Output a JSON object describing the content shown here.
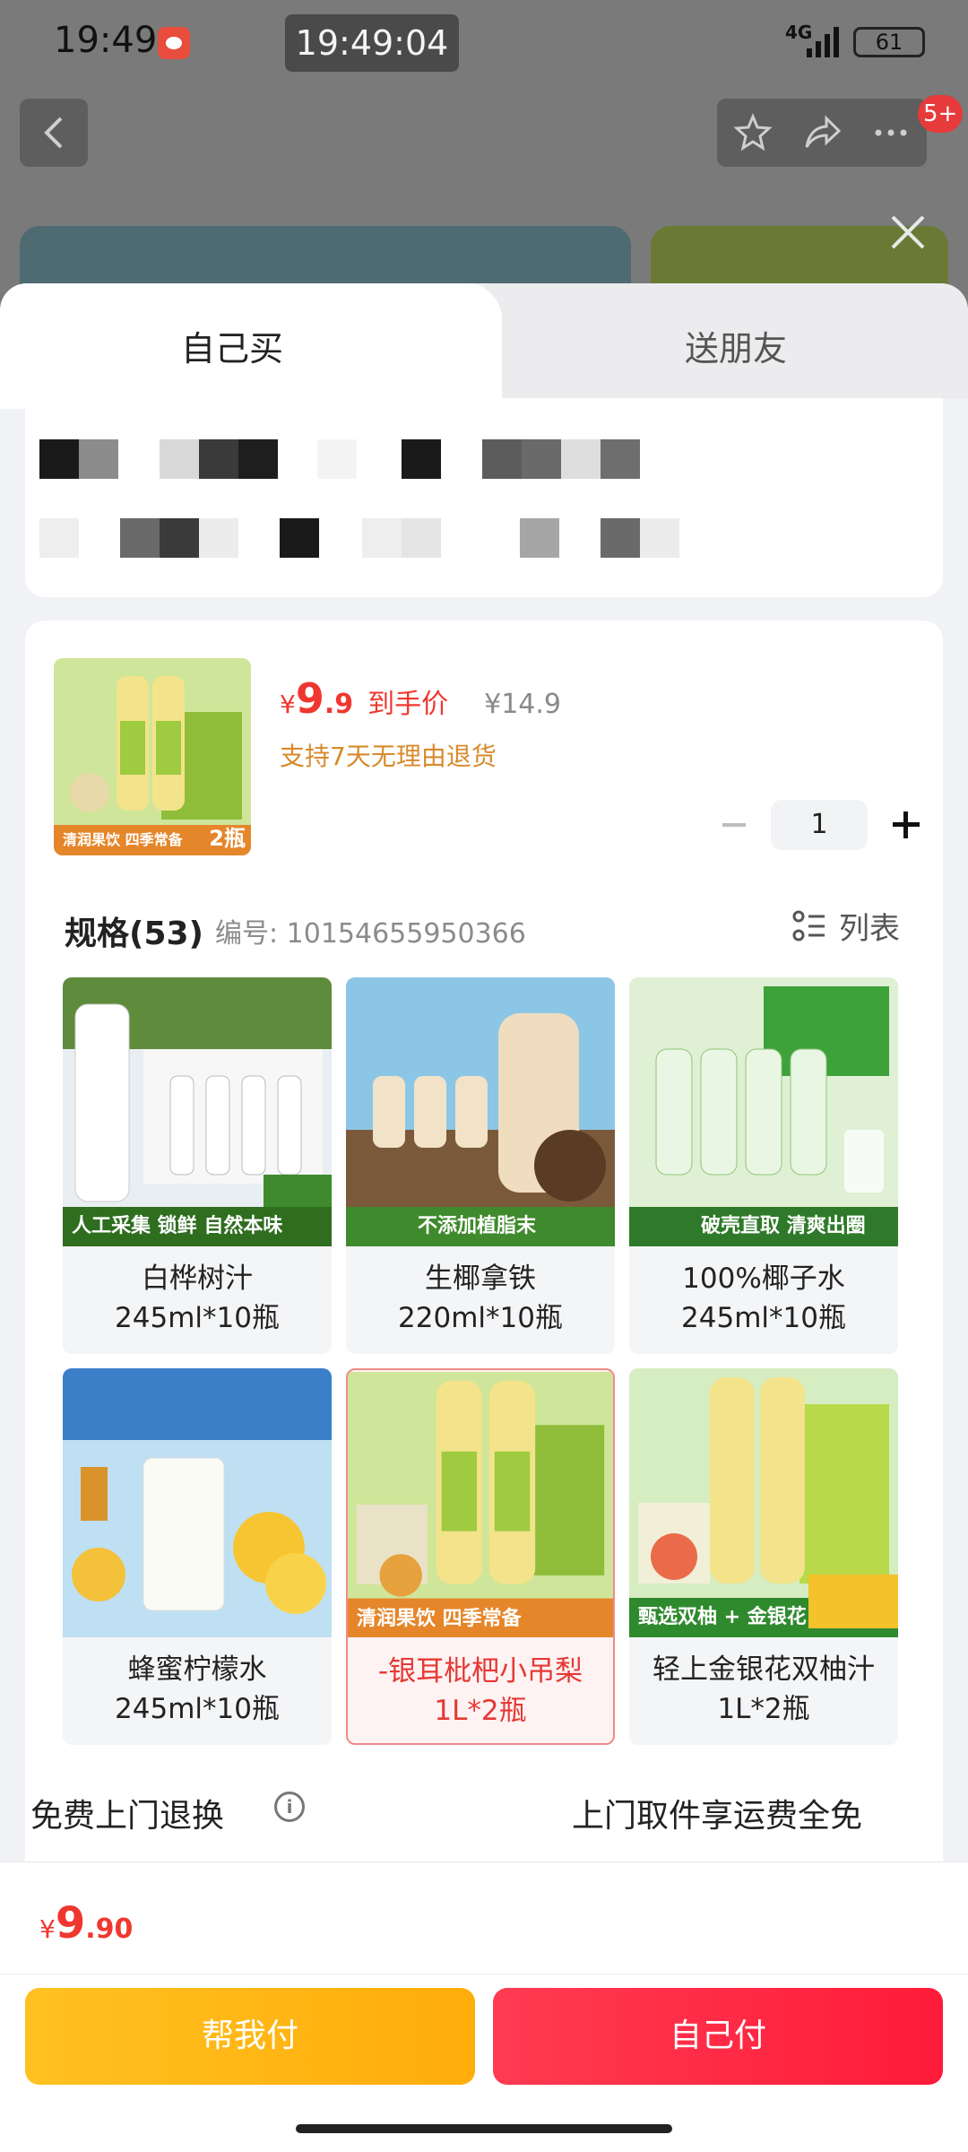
{
  "status_bar": {
    "time": "19:49",
    "clock_overlay": "19:49:04",
    "network": "4G",
    "battery": "61"
  },
  "background": {
    "badge": "5+"
  },
  "tabs": {
    "self_buy": "自己买",
    "send_friend": "送朋友"
  },
  "product": {
    "price_currency": "¥",
    "price_int": "9",
    "price_dec": ".9",
    "price_tag": "到手价",
    "original_price": "¥14.9",
    "return_policy": "支持7天无理由退货",
    "quantity": "1",
    "thumb_caption": "清润果饮 四季常备",
    "thumb_badge": "2瓶"
  },
  "specs": {
    "title": "规格(53)",
    "code": "编号: 10154655950366",
    "list_label": "列表",
    "items": [
      {
        "name": "白桦树汁",
        "size": "245ml*10瓶",
        "caption": "人工采集 锁鲜 自然本味"
      },
      {
        "name": "生椰拿铁",
        "size": "220ml*10瓶",
        "caption": "不添加植脂末"
      },
      {
        "name": "100%椰子水",
        "size": "245ml*10瓶",
        "caption": "破壳直取 清爽出圈"
      },
      {
        "name": "蜂蜜柠檬水",
        "size": "245ml*10瓶",
        "caption": ""
      },
      {
        "name": "-银耳枇杷小吊梨",
        "size": "1L*2瓶",
        "caption": "清润果饮 四季常备"
      },
      {
        "name": "轻上金银花双柚汁",
        "size": "1L*2瓶",
        "caption": "甄选双柚 + 金银花"
      }
    ]
  },
  "shipping": {
    "label": "免费上门退换",
    "info_icon": "i",
    "detail": "上门取件享运费全免"
  },
  "footer": {
    "total_currency": "¥",
    "total_int": "9",
    "total_dec": ".90",
    "help_pay": "帮我付",
    "self_pay": "自己付"
  },
  "colors": {
    "accent_red": "#f0372f",
    "help_button": "#ffb414",
    "self_button": "#ff2a45"
  }
}
